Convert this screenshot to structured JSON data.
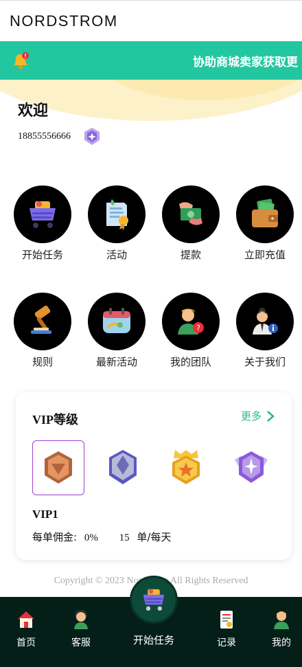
{
  "header": {
    "logo": "NORDSTROM"
  },
  "notice": {
    "icon": "bell-icon",
    "text": "协助商城卖家获取更"
  },
  "profile": {
    "welcome": "欢迎",
    "phone": "18855556666",
    "vip_icon": "vip-badge-icon"
  },
  "menu_row1": [
    {
      "label": "开始任务",
      "icon": "shopping-cart-icon"
    },
    {
      "label": "活动",
      "icon": "certificate-icon"
    },
    {
      "label": "提款",
      "icon": "cash-hand-icon"
    },
    {
      "label": "立即充值",
      "icon": "wallet-icon"
    }
  ],
  "menu_row2": [
    {
      "label": "规则",
      "icon": "gavel-icon"
    },
    {
      "label": "最新活动",
      "icon": "calendar-icon"
    },
    {
      "label": "我的团队",
      "icon": "team-person-icon"
    },
    {
      "label": "关于我们",
      "icon": "info-person-icon"
    }
  ],
  "vip": {
    "title": "VIP等级",
    "more": "更多",
    "badges": [
      {
        "icon": "bronze-badge-icon",
        "color": "#d9814f",
        "selected": true
      },
      {
        "icon": "silver-badge-icon",
        "color": "#6f6fd0",
        "selected": false
      },
      {
        "icon": "gold-badge-icon",
        "color": "#f2b531",
        "selected": false
      },
      {
        "icon": "purple-badge-icon",
        "color": "#a36be0",
        "selected": false
      }
    ],
    "level": "VIP1",
    "commission_label": "每单佣金:",
    "commission_value": "0%",
    "orders_value": "15",
    "orders_unit": "单/每天"
  },
  "footer": {
    "copyright": "Copyright © 2023 Nordstrom All Rights Reserved"
  },
  "tabbar": {
    "home": "首页",
    "service": "客服",
    "start": "开始任务",
    "records": "记录",
    "mine": "我的"
  },
  "colors": {
    "accent": "#22c7a0",
    "tabbar_bg": "#041f18",
    "vip_selected_border": "#a23fd1"
  }
}
